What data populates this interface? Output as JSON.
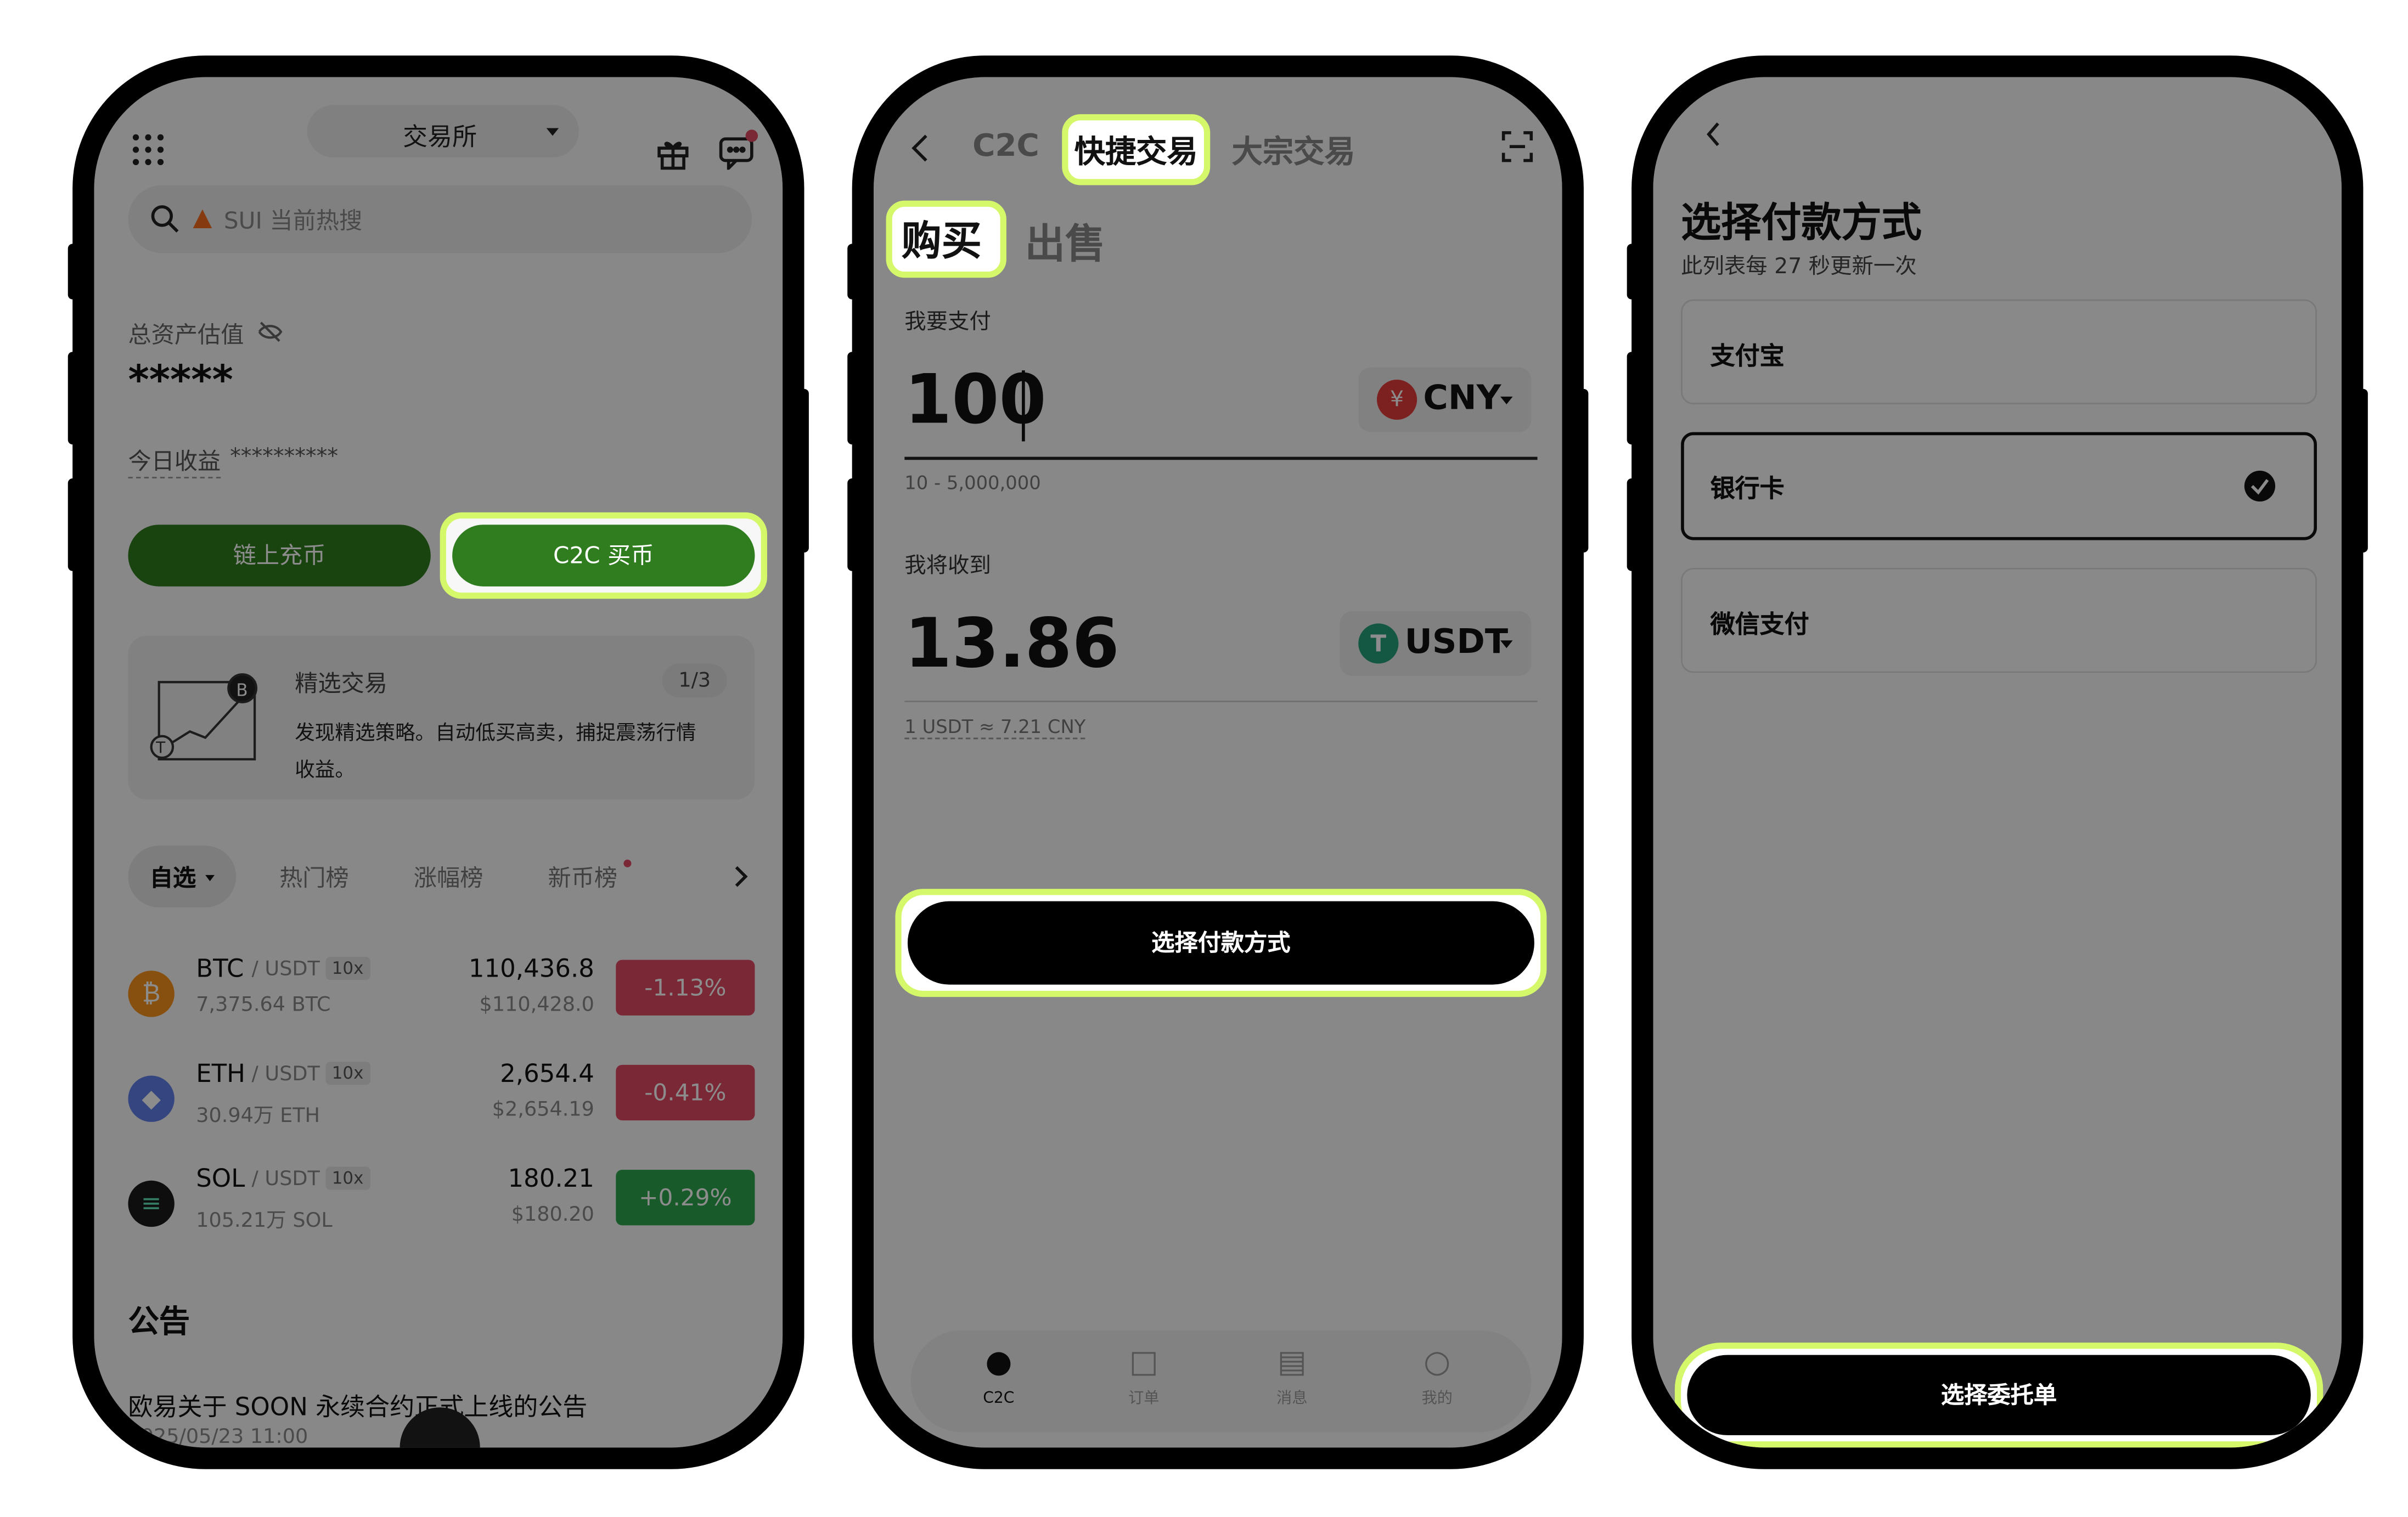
{
  "phone1": {
    "header": {
      "exchange_label": "交易所"
    },
    "search": {
      "placeholder": "SUI 当前热搜"
    },
    "assets": {
      "label": "总资产估值",
      "value": "*****",
      "today_label": "今日收益",
      "today_value": "**********"
    },
    "buttons": {
      "onchain": "链上充币",
      "c2c_buy": "C2C 买币"
    },
    "promo": {
      "title": "精选交易",
      "page": "1/3",
      "desc_line1": "发现精选策略。自动低买高卖，捕捉震荡行情",
      "desc_line2": "收益。"
    },
    "tabs": [
      {
        "label": "自选"
      },
      {
        "label": "热门榜"
      },
      {
        "label": "涨幅榜"
      },
      {
        "label": "新币榜"
      }
    ],
    "coins": [
      {
        "symbol": "BTC",
        "quote": "/ USDT",
        "lev": "10x",
        "volume": "7,375.64 BTC",
        "price": "110,436.8",
        "fiat": "$110,428.0",
        "change": "-1.13%",
        "color": "#f7931a"
      },
      {
        "symbol": "ETH",
        "quote": "/ USDT",
        "lev": "10x",
        "volume": "30.94万 ETH",
        "price": "2,654.4",
        "fiat": "$2,654.19",
        "change": "-0.41%",
        "color": "#627eea"
      },
      {
        "symbol": "SOL",
        "quote": "/ USDT",
        "lev": "10x",
        "volume": "105.21万 SOL",
        "price": "180.21",
        "fiat": "$180.20",
        "change": "+0.29%",
        "color": "#1a1a1a"
      }
    ],
    "announcement": {
      "heading": "公告",
      "title": "欧易关于 SOON 永续合约正式上线的公告",
      "date": "2025/05/23 11:00"
    }
  },
  "phone2": {
    "tabs": [
      {
        "label": "C2C"
      },
      {
        "label": "快捷交易"
      },
      {
        "label": "大宗交易"
      }
    ],
    "mode": {
      "buy": "购买",
      "sell": "出售"
    },
    "pay": {
      "label": "我要支付",
      "amount": "100",
      "currency": "CNY",
      "range": "10 - 5,000,000"
    },
    "receive": {
      "label": "我将收到",
      "amount": "13.86",
      "currency": "USDT",
      "rate": "1 USDT ≈ 7.21 CNY"
    },
    "cta": "选择付款方式",
    "nav": [
      {
        "label": "C2C"
      },
      {
        "label": "订单"
      },
      {
        "label": "消息"
      },
      {
        "label": "我的"
      }
    ]
  },
  "phone3": {
    "title": "选择付款方式",
    "subtitle": "此列表每 27 秒更新一次",
    "methods": [
      {
        "label": "支付宝"
      },
      {
        "label": "银行卡"
      },
      {
        "label": "微信支付"
      }
    ],
    "cta": "选择委托单"
  },
  "colors": {
    "highlight": "#d5f76a",
    "green": "#2f7d1e",
    "red": "#e04a63",
    "gain": "#2ea44f"
  }
}
